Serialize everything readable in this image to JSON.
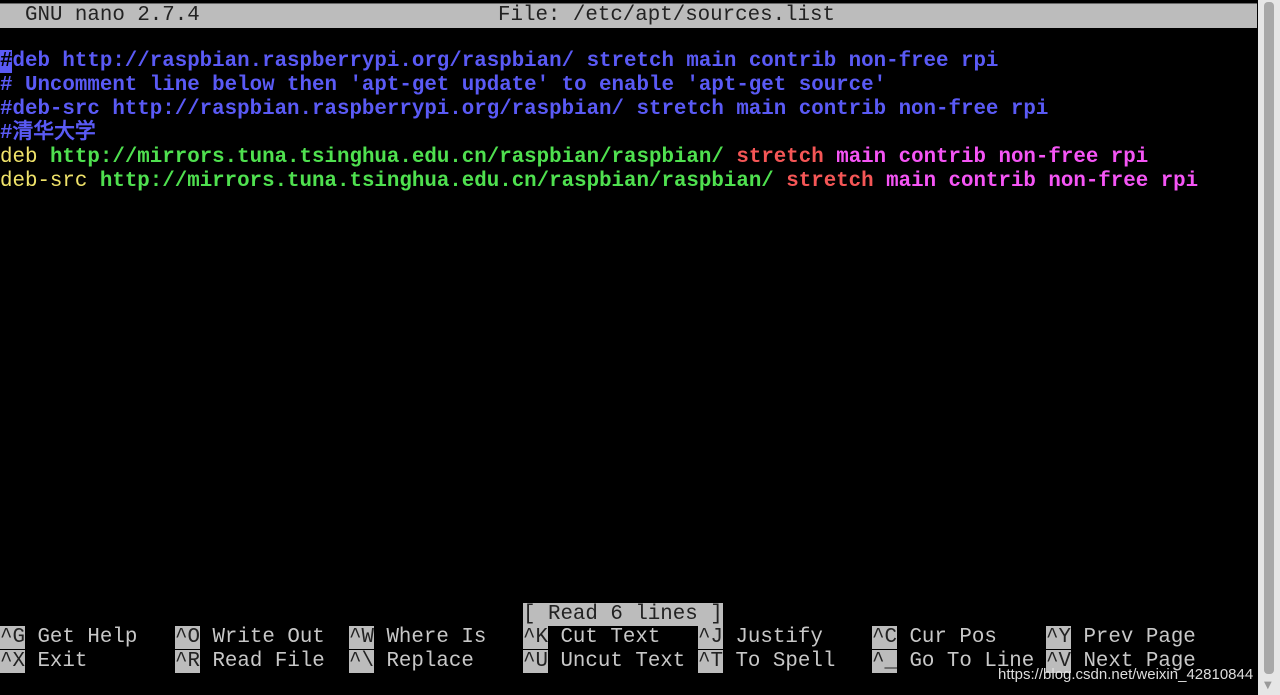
{
  "title_bar": {
    "app": "GNU nano 2.7.4",
    "file": "File: /etc/apt/sources.list"
  },
  "lines": [
    {
      "cursor": "#",
      "text": "deb http://raspbian.raspberrypi.org/raspbian/ stretch main contrib non-free rpi"
    },
    {
      "text": "# Uncomment line below then 'apt-get update' to enable 'apt-get source'"
    },
    {
      "text": "#deb-src http://raspbian.raspberrypi.org/raspbian/ stretch main contrib non-free rpi"
    },
    {
      "text": "#清华大学"
    },
    {
      "type": "deb",
      "url": "http://mirrors.tuna.tsinghua.edu.cn/raspbian/raspbian/",
      "dist": "stretch",
      "components": "main contrib non-free rpi"
    },
    {
      "type": "deb-src",
      "url": "http://mirrors.tuna.tsinghua.edu.cn/raspbian/raspbian/",
      "dist": "stretch",
      "components": "main contrib non-free rpi"
    }
  ],
  "status": "[ Read 6 lines ]",
  "shortcuts": [
    {
      "key": "^G",
      "label": "Get Help"
    },
    {
      "key": "^X",
      "label": "Exit"
    },
    {
      "key": "^O",
      "label": "Write Out"
    },
    {
      "key": "^R",
      "label": "Read File"
    },
    {
      "key": "^W",
      "label": "Where Is"
    },
    {
      "key": "^\\",
      "label": "Replace"
    },
    {
      "key": "^K",
      "label": "Cut Text"
    },
    {
      "key": "^U",
      "label": "Uncut Text"
    },
    {
      "key": "^J",
      "label": "Justify"
    },
    {
      "key": "^T",
      "label": "To Spell"
    },
    {
      "key": "^C",
      "label": "Cur Pos"
    },
    {
      "key": "^_",
      "label": "Go To Line"
    },
    {
      "key": "^Y",
      "label": "Prev Page"
    },
    {
      "key": "^V",
      "label": "Next Page"
    }
  ],
  "watermark": "https://blog.csdn.net/weixin_42810844",
  "colors": {
    "comment": "#5a5af5",
    "keyword": "#f0e36a",
    "url": "#4fe04f",
    "dist": "#f55656",
    "components": "#f555f5",
    "bar": "#bcbcbc"
  }
}
